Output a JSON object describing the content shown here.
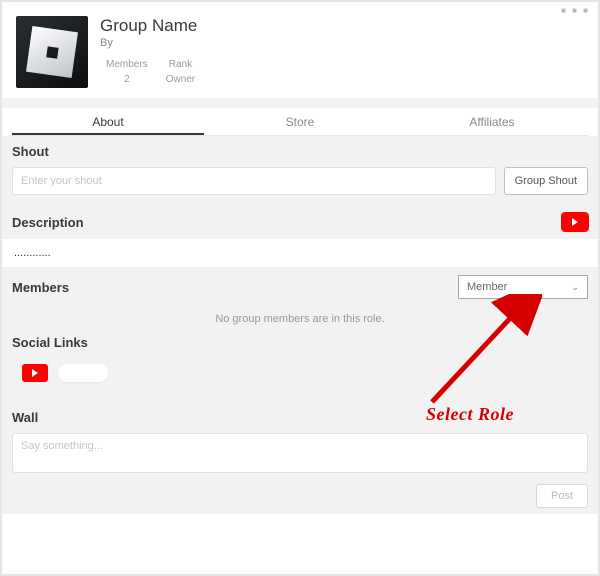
{
  "header": {
    "group_name": "Group Name",
    "by_label": "By",
    "stats": {
      "members_label": "Members",
      "members_value": "2",
      "rank_label": "Rank",
      "rank_value": "Owner"
    }
  },
  "tabs": {
    "about": "About",
    "store": "Store",
    "affiliates": "Affiliates"
  },
  "shout": {
    "title": "Shout",
    "placeholder": "Enter your shout",
    "button": "Group Shout"
  },
  "description": {
    "title": "Description",
    "body": "............"
  },
  "members": {
    "title": "Members",
    "role_selected": "Member",
    "empty_text": "No group members are in this role."
  },
  "social": {
    "title": "Social Links"
  },
  "wall": {
    "title": "Wall",
    "placeholder": "Say something...",
    "post_button": "Post"
  },
  "annotation": {
    "text": "Select Role"
  }
}
